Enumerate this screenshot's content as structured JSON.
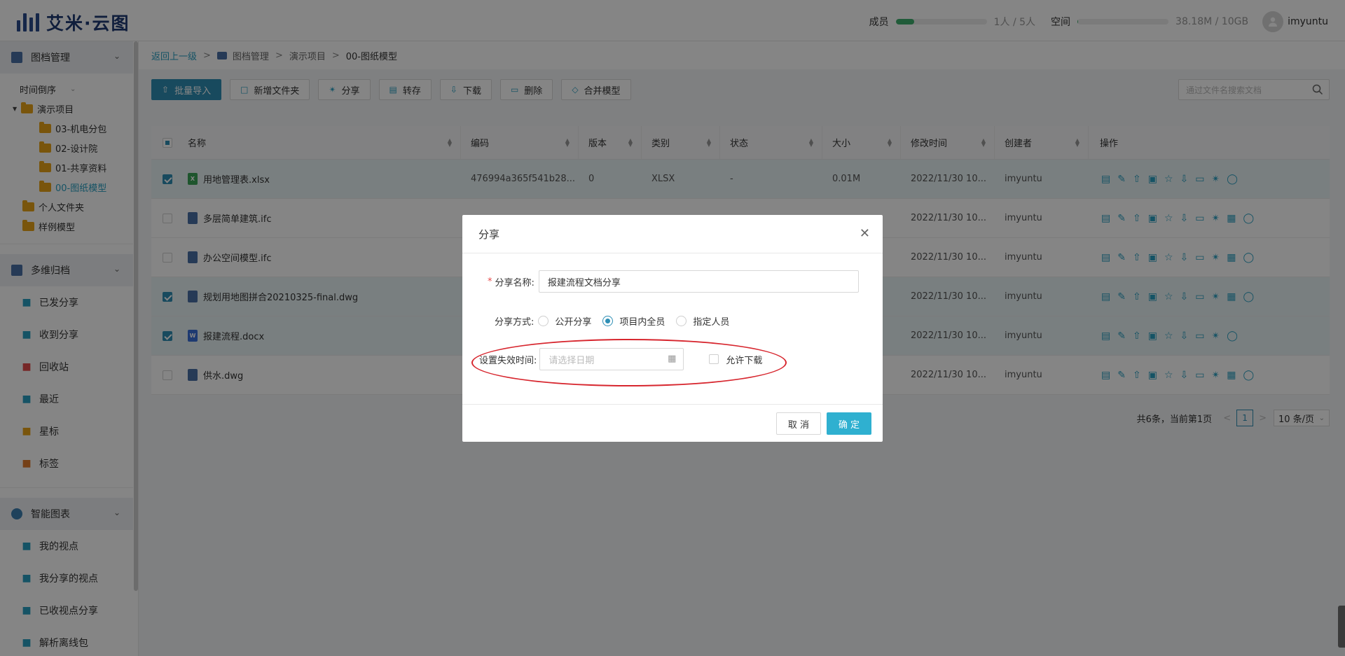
{
  "app": {
    "name": "艾米·云图"
  },
  "top": {
    "member_label": "成员",
    "member_count": "1人 / 5人",
    "member_fraction": 0.2,
    "space_label": "空间",
    "space_usage": "38.18M / 10GB",
    "space_fraction": 0.004,
    "user": "imyuntu"
  },
  "sidebar": {
    "doc_section": "图档管理",
    "sort": "时间倒序",
    "tree": [
      {
        "label": "演示项目",
        "level": 0,
        "expanded": true
      },
      {
        "label": "03-机电分包",
        "level": 1
      },
      {
        "label": "02-设计院",
        "level": 1
      },
      {
        "label": "01-共享资料",
        "level": 1
      },
      {
        "label": "00-图纸模型",
        "level": 1,
        "active": true
      },
      {
        "label": "个人文件夹",
        "level": 0
      },
      {
        "label": "样例模型",
        "level": 0
      }
    ],
    "archive_section": "多维归档",
    "archive_items": [
      {
        "label": "已发分享",
        "icon": "send-share-icon"
      },
      {
        "label": "收到分享",
        "icon": "receive-share-icon"
      },
      {
        "label": "回收站",
        "icon": "trash-icon"
      },
      {
        "label": "最近",
        "icon": "recent-icon"
      },
      {
        "label": "星标",
        "icon": "star-icon"
      },
      {
        "label": "标签",
        "icon": "tag-icon"
      }
    ],
    "chart_section": "智能图表",
    "chart_items": [
      {
        "label": "我的视点",
        "icon": "viewpoint-icon"
      },
      {
        "label": "我分享的视点",
        "icon": "shared-viewpoint-icon"
      },
      {
        "label": "已收视点分享",
        "icon": "received-viewpoint-icon"
      },
      {
        "label": "解析离线包",
        "icon": "globe-icon"
      }
    ]
  },
  "breadcrumb": {
    "back": "返回上一级",
    "items": [
      "图档管理",
      "演示项目",
      "00-图纸模型"
    ]
  },
  "toolbar": {
    "import": "批量导入",
    "new_folder": "新增文件夹",
    "share": "分享",
    "transfer": "转存",
    "download": "下载",
    "delete": "删除",
    "merge": "合并模型",
    "search_placeholder": "通过文件名搜索文档"
  },
  "table": {
    "headers": {
      "name": "名称",
      "code": "编码",
      "version": "版本",
      "type": "类别",
      "status": "状态",
      "size": "大小",
      "modified": "修改时间",
      "creator": "创建者",
      "ops": "操作"
    },
    "rows": [
      {
        "name": "用地管理表.xlsx",
        "code": "476994a365f541b28...",
        "version": "0",
        "type": "XLSX",
        "status": "-",
        "size": "0.01M",
        "modified": "2022/11/30 10...",
        "creator": "imyuntu",
        "selected": true,
        "kind": "xlsx"
      },
      {
        "name": "多层简单建筑.ifc",
        "code": "",
        "version": "",
        "type": "",
        "status": "",
        "size": "",
        "modified": "2022/11/30 10...",
        "creator": "imyuntu",
        "selected": false,
        "kind": "ifc"
      },
      {
        "name": "办公空间模型.ifc",
        "code": "",
        "version": "",
        "type": "",
        "status": "",
        "size": "",
        "modified": "2022/11/30 10...",
        "creator": "imyuntu",
        "selected": false,
        "kind": "ifc"
      },
      {
        "name": "规划用地图拼合20210325-final.dwg",
        "code": "",
        "version": "",
        "type": "",
        "status": "",
        "size": "",
        "modified": "2022/11/30 10...",
        "creator": "imyuntu",
        "selected": true,
        "kind": "dwg"
      },
      {
        "name": "报建流程.docx",
        "code": "",
        "version": "",
        "type": "",
        "status": "",
        "size": "",
        "modified": "2022/11/30 10...",
        "creator": "imyuntu",
        "selected": true,
        "kind": "docx"
      },
      {
        "name": "供水.dwg",
        "code": "",
        "version": "",
        "type": "",
        "status": "",
        "size": "",
        "modified": "2022/11/30 10...",
        "creator": "imyuntu",
        "selected": false,
        "kind": "dwg"
      }
    ]
  },
  "pager": {
    "summary": "共6条，当前第1页",
    "page": "1",
    "page_size": "10 条/页"
  },
  "modal": {
    "title": "分享",
    "name_label": "分享名称:",
    "name_value": "报建流程文档分享",
    "mode_label": "分享方式:",
    "modes": [
      {
        "label": "公开分享",
        "checked": false
      },
      {
        "label": "项目内全员",
        "checked": true
      },
      {
        "label": "指定人员",
        "checked": false
      }
    ],
    "expire_label": "设置失效时间:",
    "date_placeholder": "请选择日期",
    "allow_download": "允许下载",
    "cancel": "取 消",
    "confirm": "确 定"
  },
  "colors": {
    "accent": "#2e8fb5",
    "brand": "#1f3a73",
    "highlight_ellipse": "#d7262e",
    "folder": "#e8a317"
  }
}
